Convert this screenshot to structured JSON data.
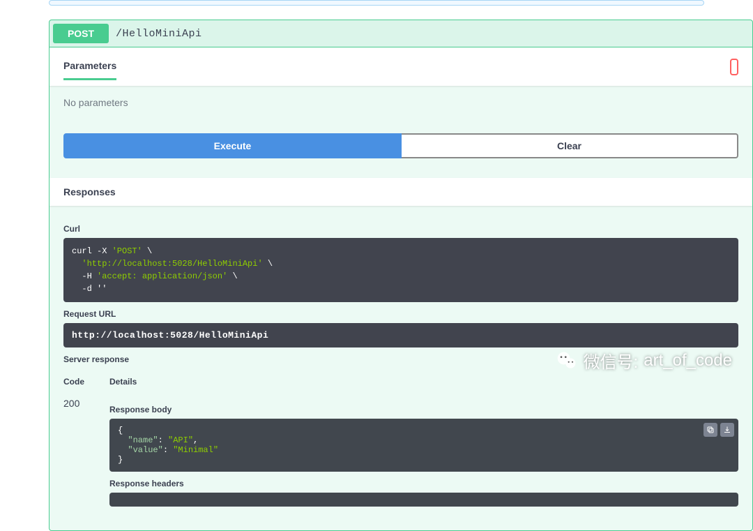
{
  "endpoint": {
    "method": "POST",
    "path": "/HelloMiniApi"
  },
  "tabs": {
    "parameters": "Parameters"
  },
  "no_parameters_text": "No parameters",
  "buttons": {
    "execute": "Execute",
    "clear": "Clear"
  },
  "responses_header": "Responses",
  "labels": {
    "curl": "Curl",
    "request_url": "Request URL",
    "server_response": "Server response",
    "code": "Code",
    "details": "Details",
    "response_body": "Response body",
    "response_headers": "Response headers"
  },
  "curl_command": {
    "line1_prefix": "curl -X ",
    "line1_method": "'POST'",
    "line1_suffix": " \\",
    "line2_url": "'http://localhost:5028/HelloMiniApi'",
    "line2_suffix": " \\",
    "line3_prefix": "  -H ",
    "line3_header": "'accept: application/json'",
    "line3_suffix": " \\",
    "line4": "  -d ''"
  },
  "request_url": "http://localhost:5028/HelloMiniApi",
  "response": {
    "status_code": "200",
    "body_lines": {
      "open": "{",
      "name_key": "  \"name\"",
      "name_sep": ": ",
      "name_val": "\"API\"",
      "name_comma": ",",
      "value_key": "  \"value\"",
      "value_sep": ": ",
      "value_val": "\"Minimal\"",
      "close": "}"
    }
  },
  "watermark": {
    "label": "微信号:",
    "handle": "art_of_code"
  }
}
